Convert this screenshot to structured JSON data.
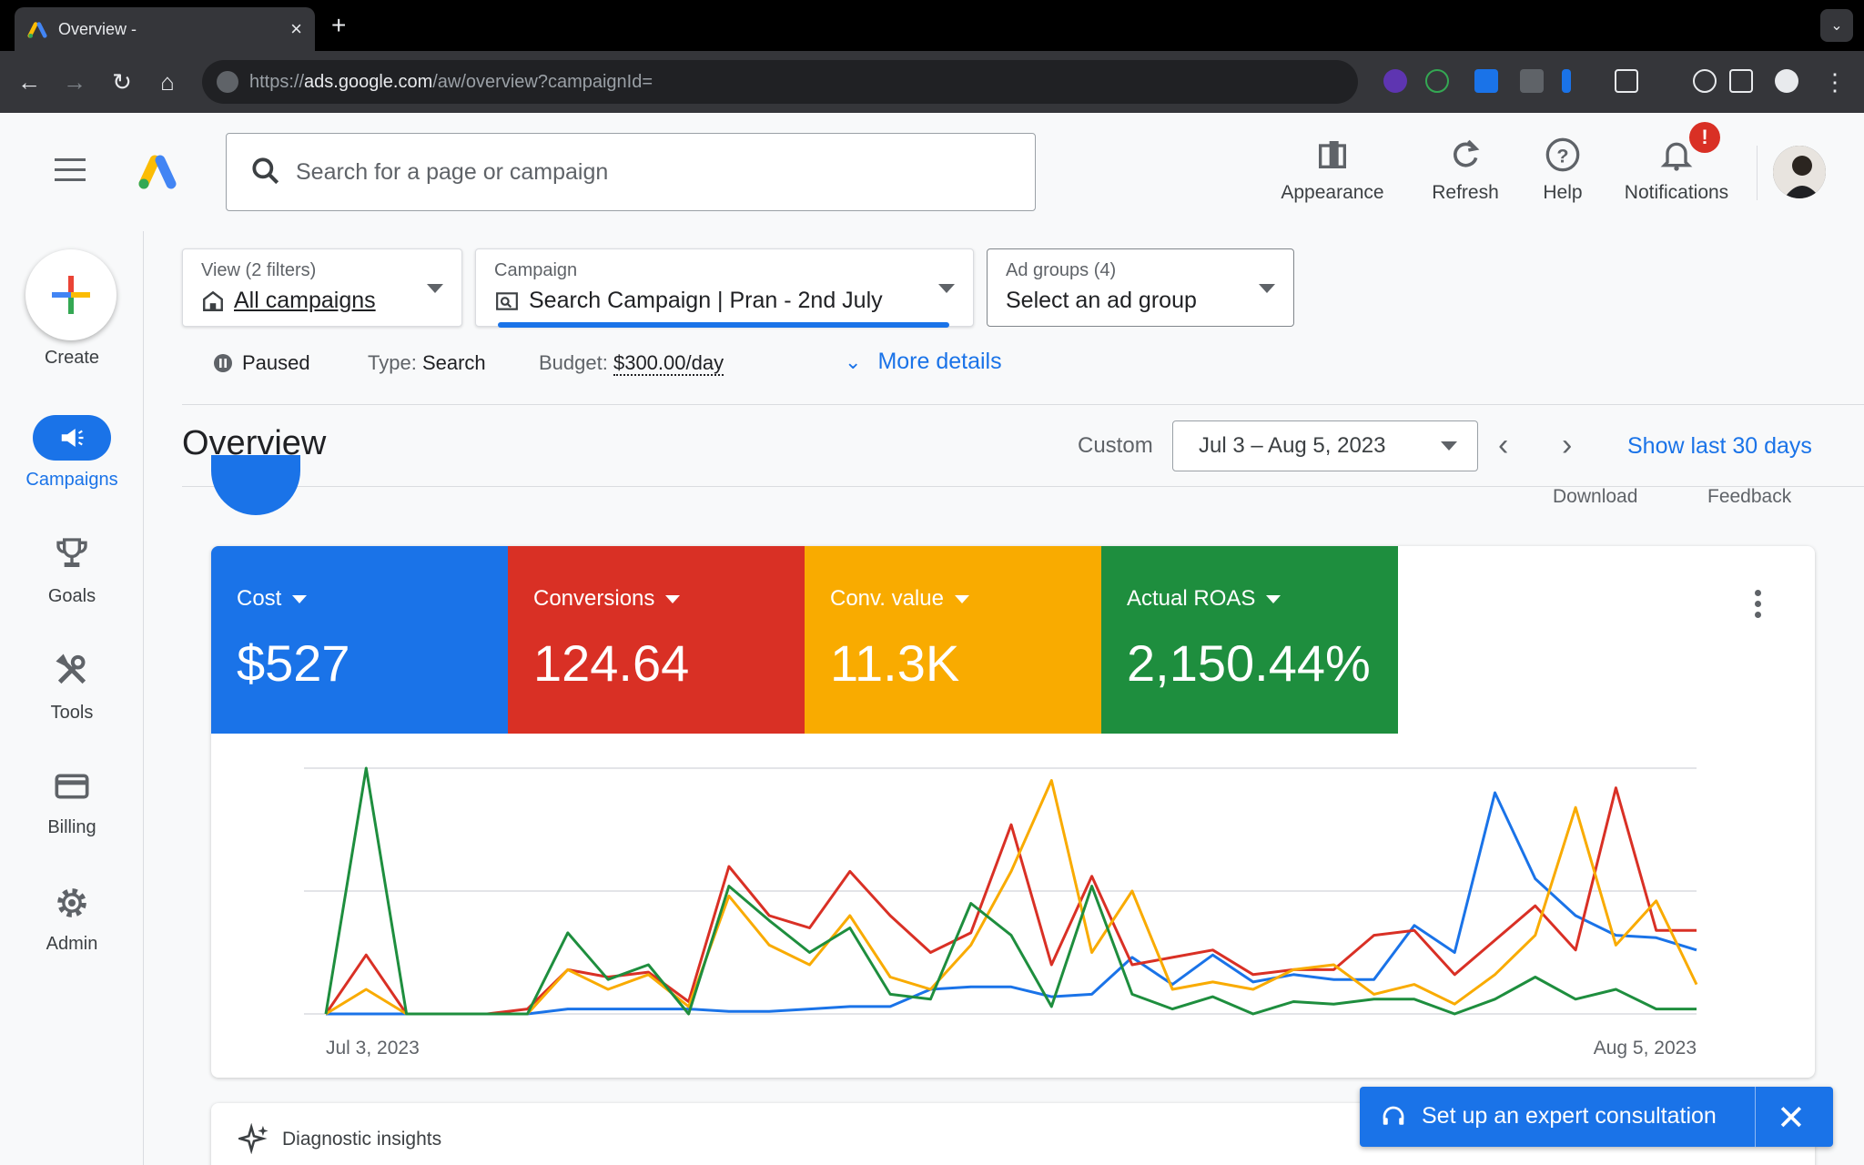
{
  "browser": {
    "tab_title": "Overview -",
    "tab_close": "×",
    "new_tab": "+",
    "url_prefix": "https://",
    "url_host": "ads.google.com",
    "url_path": "/aw/overview?campaignId="
  },
  "header": {
    "search_placeholder": "Search for a page or campaign",
    "appearance_label": "Appearance",
    "refresh_label": "Refresh",
    "help_label": "Help",
    "notifications_label": "Notifications",
    "notifications_badge": "!"
  },
  "rail": {
    "create": "Create",
    "campaigns": "Campaigns",
    "goals": "Goals",
    "tools": "Tools",
    "billing": "Billing",
    "admin": "Admin"
  },
  "filters": {
    "view_label": "View (2 filters)",
    "view_value": "All campaigns",
    "campaign_label": "Campaign",
    "campaign_value": "Search Campaign | Pran - 2nd July",
    "adgroups_label": "Ad groups (4)",
    "adgroups_value": "Select an ad group"
  },
  "status": {
    "state": "Paused",
    "type_label": "Type:",
    "type_value": "Search",
    "budget_label": "Budget:",
    "budget_value": "$300.00/day",
    "more_details": "More details"
  },
  "overview": {
    "title": "Overview",
    "custom": "Custom",
    "date_range": "Jul 3 – Aug 5, 2023",
    "show_last": "Show last 30 days",
    "download": "Download",
    "feedback": "Feedback"
  },
  "metrics": [
    {
      "label": "Cost",
      "value": "$527",
      "color": "#1a73e8"
    },
    {
      "label": "Conversions",
      "value": "124.64",
      "color": "#d93025"
    },
    {
      "label": "Conv. value",
      "value": "11.3K",
      "color": "#f9ab00"
    },
    {
      "label": "Actual ROAS",
      "value": "2,150.44%",
      "color": "#1e8e3e"
    }
  ],
  "chart_data": {
    "type": "line",
    "x_start_label": "Jul 3, 2023",
    "x_end_label": "Aug 5, 2023",
    "ylim": [
      0,
      100
    ],
    "grid": true,
    "series": [
      {
        "color": "#1a73e8",
        "values": [
          0,
          0,
          0,
          0,
          0,
          0,
          2,
          2,
          2,
          2,
          1,
          1,
          2,
          3,
          3,
          10,
          11,
          11,
          7,
          8,
          23,
          12,
          24,
          13,
          16,
          14,
          14,
          36,
          25,
          90,
          55,
          40,
          32,
          31,
          26
        ]
      },
      {
        "color": "#d93025",
        "values": [
          0,
          24,
          0,
          0,
          0,
          2,
          18,
          15,
          17,
          5,
          60,
          40,
          35,
          58,
          40,
          25,
          33,
          77,
          20,
          56,
          20,
          23,
          26,
          16,
          18,
          18,
          32,
          34,
          16,
          30,
          44,
          26,
          92,
          34,
          34
        ]
      },
      {
        "color": "#f9ab00",
        "values": [
          0,
          10,
          0,
          0,
          0,
          0,
          18,
          10,
          16,
          3,
          48,
          28,
          20,
          40,
          15,
          10,
          28,
          58,
          95,
          25,
          50,
          10,
          13,
          10,
          18,
          20,
          8,
          12,
          4,
          16,
          32,
          84,
          28,
          46,
          12
        ]
      },
      {
        "color": "#1e8e3e",
        "values": [
          0,
          100,
          0,
          0,
          0,
          0,
          33,
          14,
          20,
          0,
          52,
          38,
          25,
          35,
          8,
          6,
          45,
          32,
          3,
          52,
          8,
          2,
          7,
          0,
          5,
          4,
          6,
          6,
          0,
          6,
          15,
          6,
          10,
          2,
          2
        ]
      }
    ]
  },
  "diagnostics": {
    "label": "Diagnostic insights"
  },
  "consult": {
    "label": "Set up an expert consultation",
    "close": "✕"
  }
}
